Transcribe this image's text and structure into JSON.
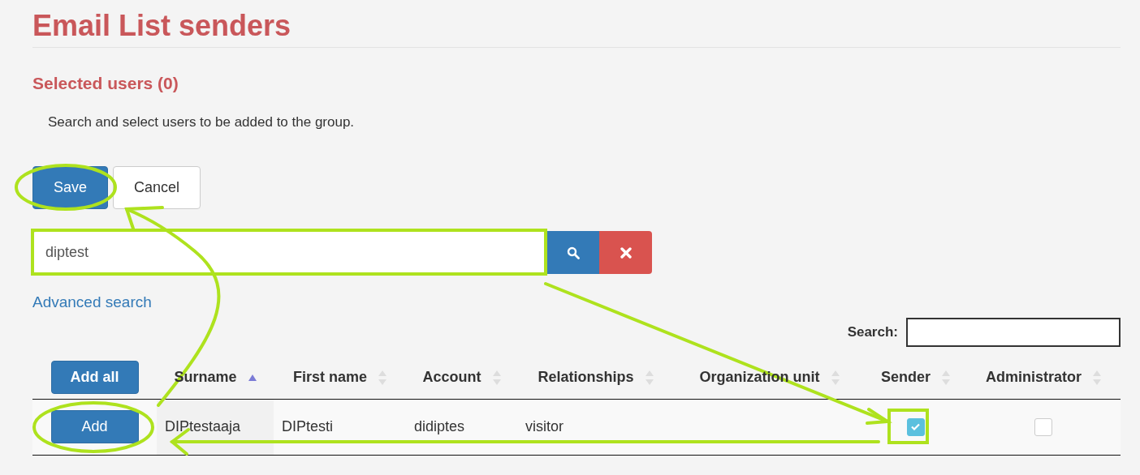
{
  "page_title": "Email List senders",
  "selected_heading": "Selected users (0)",
  "instructions": "Search and select users to be added to the group.",
  "actions": [
    {
      "label": "Save",
      "kind": "primary"
    },
    {
      "label": "Cancel",
      "kind": "default"
    }
  ],
  "search": {
    "value": "diptest"
  },
  "advanced_search": "Advanced search",
  "table_filter": {
    "label": "Search:"
  },
  "table": {
    "add_all": "Add all",
    "columns": [
      {
        "label": "Surname",
        "sorted": true
      },
      {
        "label": "First name",
        "sorted": false
      },
      {
        "label": "Account",
        "sorted": false
      },
      {
        "label": "Relationships",
        "sorted": false
      },
      {
        "label": "Organization unit",
        "sorted": false
      },
      {
        "label": "Sender",
        "sorted": false
      },
      {
        "label": "Administrator",
        "sorted": false
      }
    ],
    "rows": [
      {
        "add": "Add",
        "surname": "DIPtestaaja",
        "first_name": "DIPtesti",
        "account": "didiptes",
        "relationships": "visitor",
        "sender": true,
        "administrator": false
      }
    ]
  }
}
